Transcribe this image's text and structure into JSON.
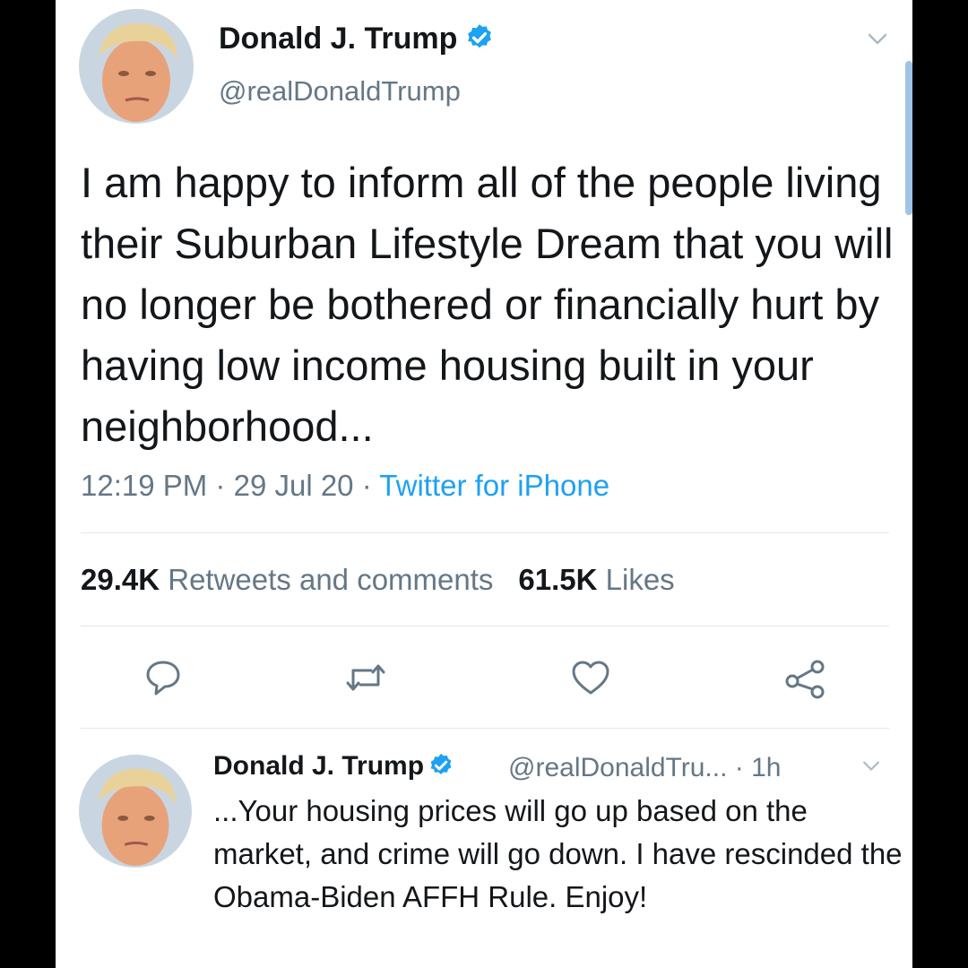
{
  "tweet": {
    "author_name": "Donald J. Trump",
    "author_handle": "@realDonaldTrump",
    "text": "I am happy to inform all of the people living their Suburban Lifestyle Dream that you will no longer be bothered or financially hurt by having low income housing built in your neighborhood...",
    "time": "12:19 PM",
    "sep1": "·",
    "date": "29 Jul 20",
    "sep2": "·",
    "source": "Twitter for iPhone",
    "retweets_count": "29.4K",
    "retweets_label": "Retweets and comments",
    "likes_count": "61.5K",
    "likes_label": "Likes"
  },
  "actions": {
    "reply_icon": "reply-icon",
    "retweet_icon": "retweet-icon",
    "like_icon": "heart-icon",
    "share_icon": "share-icon"
  },
  "reply_tweet": {
    "author_name": "Donald J. Trump",
    "author_handle_time": "@realDonaldTru... · 1h",
    "text": "...Your housing prices will go up based on the market, and crime will go down. I have rescinded the Obama-Biden AFFH Rule. Enjoy!"
  },
  "colors": {
    "accent": "#1da1f2",
    "text": "#14171a",
    "secondary": "#657786",
    "divider": "#e1e8ed"
  }
}
